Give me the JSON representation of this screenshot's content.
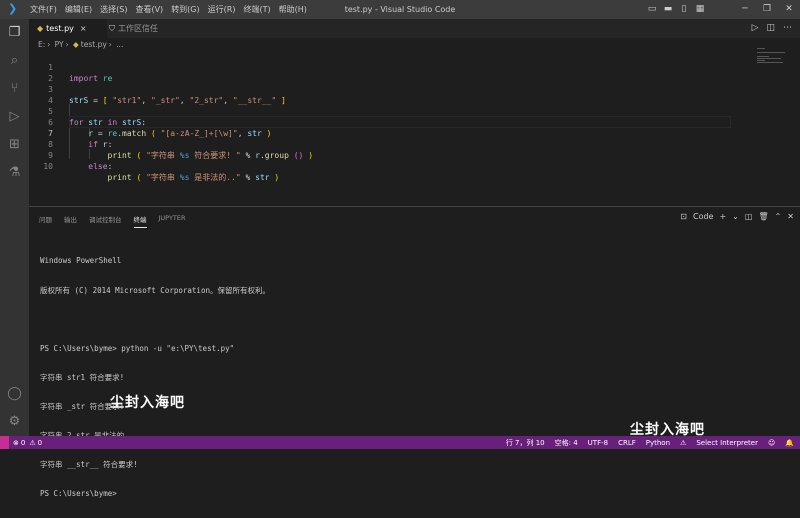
{
  "titlebar": {
    "menu": [
      "文件(F)",
      "编辑(E)",
      "选择(S)",
      "查看(V)",
      "转到(G)",
      "运行(R)",
      "终端(T)",
      "帮助(H)"
    ],
    "window_title": "test.py - Visual Studio Code"
  },
  "tabs": [
    {
      "label": "test.py",
      "active": true
    },
    {
      "label": "工作区信任",
      "active": false
    }
  ],
  "breadcrumb": [
    "E:",
    "PY",
    "test.py",
    "..."
  ],
  "editor": {
    "lines": [
      {
        "n": "1",
        "text": "import re"
      },
      {
        "n": "2",
        "text": ""
      },
      {
        "n": "3",
        "text": "strS = [ \"str1\", \"_str\", \"2_str\", \"__str__\" ]"
      },
      {
        "n": "4",
        "text": ""
      },
      {
        "n": "5",
        "text": "for str in strS:"
      },
      {
        "n": "6",
        "text": "    r = re.match ( \"[a-zA-Z_]+[\\w]\", str )"
      },
      {
        "n": "7",
        "text": "    if r:"
      },
      {
        "n": "8",
        "text": "        print ( \"字符串 %s 符合要求! \" % r.group () )"
      },
      {
        "n": "9",
        "text": "    else:"
      },
      {
        "n": "10",
        "text": "        print ( \"字符串 %s 是非法的..\" % str )"
      }
    ]
  },
  "panel": {
    "tabs": [
      "问题",
      "输出",
      "调试控制台",
      "终端",
      "JUPYTER"
    ],
    "active_tab": "终端",
    "shell_label": "Code",
    "terminal_lines": [
      "Windows PowerShell",
      "版权所有 (C) 2014 Microsoft Corporation。保留所有权利。",
      "",
      "PS C:\\Users\\byme> python -u \"e:\\PY\\test.py\"",
      "字符串 str1 符合要求!",
      "字符串 _str 符合要求!",
      "字符串 2_str 是非法的..",
      "字符串 __str__ 符合要求!",
      "PS C:\\Users\\byme>"
    ]
  },
  "watermarks": [
    "尘封入海吧",
    "尘封入海吧"
  ],
  "statusbar": {
    "errors": "0",
    "warnings": "0",
    "position": "行 7，列 10",
    "spaces": "空格: 4",
    "encoding": "UTF-8",
    "eol": "CRLF",
    "language": "Python",
    "interpreter": "Select Interpreter"
  },
  "colors": {
    "statusbar": "#68217a",
    "titlebar": "#3c3c3c",
    "activitybar": "#333333",
    "editor_bg": "#1e1e1e"
  }
}
